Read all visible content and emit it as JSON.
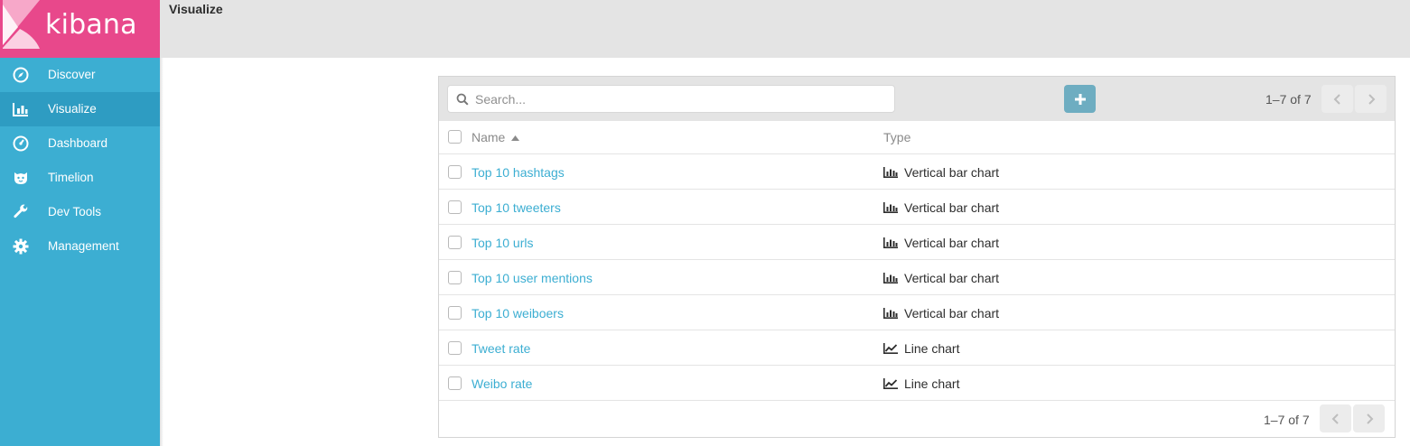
{
  "app": {
    "brand": "kibana",
    "page_title": "Visualize"
  },
  "sidebar": {
    "items": [
      {
        "label": "Discover",
        "icon": "compass-icon",
        "active": false
      },
      {
        "label": "Visualize",
        "icon": "bar-chart-icon",
        "active": true
      },
      {
        "label": "Dashboard",
        "icon": "dashboard-icon",
        "active": false
      },
      {
        "label": "Timelion",
        "icon": "timelion-icon",
        "active": false
      },
      {
        "label": "Dev Tools",
        "icon": "wrench-icon",
        "active": false
      },
      {
        "label": "Management",
        "icon": "gear-icon",
        "active": false
      }
    ]
  },
  "search": {
    "placeholder": "Search...",
    "value": ""
  },
  "pagination": {
    "count_label": "1–7 of 7"
  },
  "table": {
    "columns": {
      "name": "Name",
      "type": "Type"
    },
    "rows": [
      {
        "name": "Top 10 hashtags",
        "type": "Vertical bar chart",
        "type_icon": "bar-chart-icon"
      },
      {
        "name": "Top 10 tweeters",
        "type": "Vertical bar chart",
        "type_icon": "bar-chart-icon"
      },
      {
        "name": "Top 10 urls",
        "type": "Vertical bar chart",
        "type_icon": "bar-chart-icon"
      },
      {
        "name": "Top 10 user mentions",
        "type": "Vertical bar chart",
        "type_icon": "bar-chart-icon"
      },
      {
        "name": "Top 10 weiboers",
        "type": "Vertical bar chart",
        "type_icon": "bar-chart-icon"
      },
      {
        "name": "Tweet rate",
        "type": "Line chart",
        "type_icon": "line-chart-icon"
      },
      {
        "name": "Weibo rate",
        "type": "Line chart",
        "type_icon": "line-chart-icon"
      }
    ]
  },
  "colors": {
    "logo_bg": "#e8488b",
    "sidebar_bg": "#3caed2",
    "sidebar_active": "#2e9cc2",
    "link": "#3caed2",
    "add_button": "#6eadc1"
  }
}
